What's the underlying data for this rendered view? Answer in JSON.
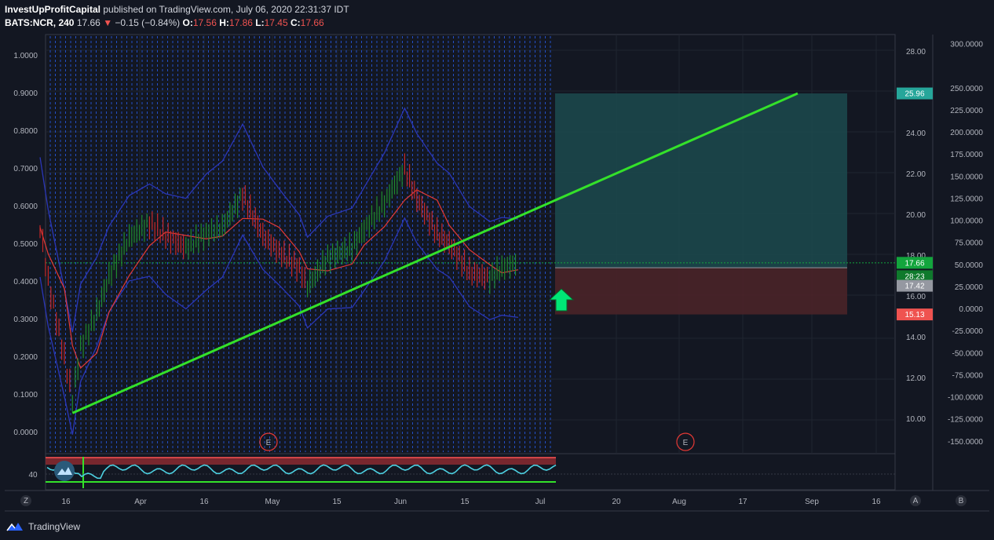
{
  "header": {
    "author": "InvestUpProfitCapital",
    "published_text": "published on TradingView.com, July 06, 2020 22:31:37 IDT",
    "symbol": "BATS:NCR, 240",
    "last": "17.66",
    "change": "−0.15 (−0.84%)",
    "o_label": "O:",
    "o_value": "17.56",
    "h_label": "H:",
    "h_value": "17.86",
    "l_label": "L:",
    "l_value": "17.45",
    "c_label": "C:",
    "c_value": "17.66"
  },
  "footer": {
    "brand": "TradingView"
  },
  "colors": {
    "background": "#131722",
    "up": "#26a69a",
    "down": "#ef5350",
    "trendline": "#34e12a",
    "target_zone": "#1c4a4e",
    "stop_zone": "#4a2428",
    "price_tag": "#13a53d",
    "target_tag": "#26a69a",
    "stop_tag": "#ef5350"
  },
  "chart_data": {
    "type": "line",
    "instrument": "BATS:NCR",
    "interval": "240",
    "left_axis": {
      "ticks": [
        "1.0000",
        "0.9000",
        "0.8000",
        "0.7000",
        "0.6000",
        "0.5000",
        "0.4000",
        "0.3000",
        "0.2000",
        "0.1000",
        "0.0000"
      ]
    },
    "price_axis": {
      "ticks": [
        "28.00",
        "24.00",
        "22.00",
        "20.00",
        "18.00",
        "16.00",
        "14.00",
        "12.00",
        "10.00"
      ]
    },
    "right_axis": {
      "ticks": [
        "300.0000",
        "250.0000",
        "225.0000",
        "200.0000",
        "175.0000",
        "150.0000",
        "125.0000",
        "100.0000",
        "75.0000",
        "50.0000",
        "25.0000",
        "0.0000",
        "-25.0000",
        "-50.0000",
        "-75.0000",
        "-100.0000",
        "-125.0000",
        "-150.0000"
      ]
    },
    "x_ticks": [
      "16",
      "Apr",
      "16",
      "May",
      "15",
      "Jun",
      "15",
      "Jul",
      "20",
      "Aug",
      "17",
      "Sep",
      "16"
    ],
    "price_tags": [
      {
        "label": "25.96",
        "role": "target"
      },
      {
        "label": "17.66",
        "role": "last"
      },
      {
        "label": "28:23",
        "role": "countdown"
      },
      {
        "label": "17.42",
        "role": "level"
      },
      {
        "label": "15.13",
        "role": "stop"
      }
    ],
    "earnings_markers": [
      "E",
      "E"
    ],
    "oscillator": {
      "tick": "40"
    },
    "scale_buttons": [
      "Z",
      "A",
      "B"
    ],
    "trendline": {
      "x": [
        "2020-03-18",
        "2020-09-13"
      ],
      "y": [
        10.3,
        25.96
      ]
    },
    "position": {
      "entry": 17.42,
      "target": 25.96,
      "stop": 15.13
    },
    "close_series": {
      "x": [
        "2020-03-10",
        "2020-03-12",
        "2020-03-16",
        "2020-03-18",
        "2020-03-20",
        "2020-03-24",
        "2020-03-27",
        "2020-04-01",
        "2020-04-06",
        "2020-04-10",
        "2020-04-15",
        "2020-04-20",
        "2020-04-24",
        "2020-04-29",
        "2020-05-04",
        "2020-05-08",
        "2020-05-13",
        "2020-05-15",
        "2020-05-20",
        "2020-05-26",
        "2020-05-29",
        "2020-06-03",
        "2020-06-08",
        "2020-06-11",
        "2020-06-16",
        "2020-06-19",
        "2020-06-24",
        "2020-06-29",
        "2020-07-02",
        "2020-07-06"
      ],
      "y": [
        19.4,
        16.8,
        13.0,
        11.0,
        13.5,
        15.2,
        17.0,
        18.9,
        19.6,
        19.0,
        18.4,
        19.1,
        19.4,
        21.0,
        19.0,
        18.2,
        17.4,
        16.5,
        17.9,
        18.4,
        19.3,
        20.6,
        22.3,
        20.8,
        19.1,
        18.6,
        17.2,
        16.9,
        17.4,
        17.66
      ]
    }
  }
}
